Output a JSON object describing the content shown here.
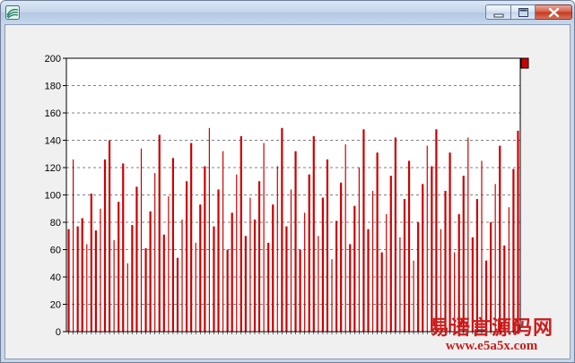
{
  "window": {
    "title": ""
  },
  "watermark": {
    "line1": "易语言源码网",
    "line2": "www.e5a5x.com"
  },
  "colors": {
    "bar": "#cc0000",
    "grid": "#808080",
    "watermark": "#cc1d1d"
  },
  "chart_data": {
    "type": "bar",
    "title": "",
    "xlabel": "",
    "ylabel": "",
    "ylim": [
      0,
      200
    ],
    "yticks": [
      0,
      20,
      40,
      60,
      80,
      100,
      120,
      140,
      160,
      180,
      200
    ],
    "grid": true,
    "legend": "top-right",
    "values": [
      75,
      126,
      77,
      83,
      64,
      101,
      74,
      90,
      126,
      140,
      67,
      95,
      123,
      50,
      78,
      106,
      134,
      61,
      88,
      116,
      144,
      71,
      99,
      127,
      54,
      82,
      110,
      138,
      65,
      93,
      121,
      149,
      77,
      104,
      132,
      60,
      87,
      115,
      143,
      70,
      98,
      82,
      110,
      138,
      65,
      93,
      121,
      149,
      77,
      104,
      132,
      60,
      87,
      115,
      143,
      70,
      98,
      126,
      53,
      81,
      109,
      137,
      64,
      92,
      120,
      148,
      75,
      103,
      131,
      58,
      86,
      114,
      142,
      69,
      97,
      125,
      52,
      80,
      108,
      136,
      121,
      148,
      75,
      103,
      131,
      58,
      86,
      114,
      142,
      69,
      97,
      125,
      52,
      80,
      108,
      136,
      63,
      91,
      119,
      147
    ]
  }
}
